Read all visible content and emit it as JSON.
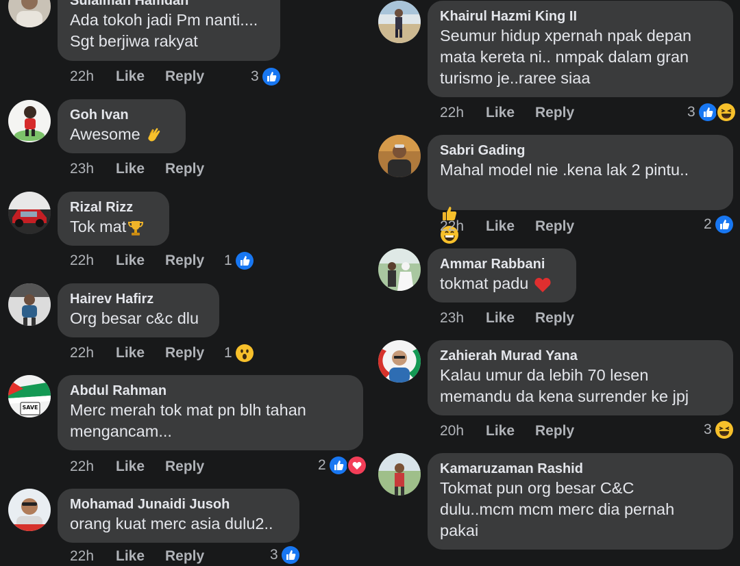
{
  "left": [
    {
      "name": "Sulaiman Hamdan",
      "text": "Ada tokoh jadi Pm nanti....\nSgt berjiwa rakyat",
      "time": "22h",
      "like": "Like",
      "reply": "Reply",
      "count": "3",
      "reactions": [
        "like"
      ]
    },
    {
      "name": "Goh Ivan",
      "text": "Awesome",
      "time": "23h",
      "like": "Like",
      "reply": "Reply",
      "count": "",
      "reactions": [],
      "emoji": "clap-icon"
    },
    {
      "name": "Rizal Rizz",
      "text": "Tok mat",
      "time": "22h",
      "like": "Like",
      "reply": "Reply",
      "count": "1",
      "reactions": [
        "like"
      ],
      "emoji": "trophy-icon"
    },
    {
      "name": "Hairev Hafirz",
      "text": "Org besar c&c dlu",
      "time": "22h",
      "like": "Like",
      "reply": "Reply",
      "count": "1",
      "reactions": [
        "wow"
      ]
    },
    {
      "name": "Abdul Rahman",
      "text": "Merc merah tok mat pn blh tahan\nmengancam...",
      "time": "22h",
      "like": "Like",
      "reply": "Reply",
      "count": "2",
      "reactions": [
        "like",
        "love"
      ]
    },
    {
      "name": "Mohamad Junaidi Jusoh",
      "text": "orang kuat merc asia dulu2..",
      "time": "22h",
      "like": "Like",
      "reply": "Reply",
      "count": "3",
      "reactions": [
        "like"
      ]
    }
  ],
  "right": [
    {
      "name": "Khairul Hazmi King II",
      "text": "Seumur hidup xpernah npak depan\nmata kereta ni.. nmpak dalam gran\nturismo je..raree siaa",
      "time": "22h",
      "like": "Like",
      "reply": "Reply",
      "count": "3",
      "reactions": [
        "like",
        "haha"
      ]
    },
    {
      "name": "Sabri Gading",
      "text": "Mahal model nie .kena lak 2 pintu..",
      "time": "22h",
      "like": "Like",
      "reply": "Reply",
      "count": "2",
      "reactions": [
        "like"
      ],
      "emoji_line": [
        "thumbs-up-icon",
        "grin-icon"
      ]
    },
    {
      "name": "Ammar Rabbani",
      "text": "tokmat padu",
      "time": "23h",
      "like": "Like",
      "reply": "Reply",
      "count": "",
      "reactions": [],
      "emoji": "heart-icon"
    },
    {
      "name": "Zahierah Murad Yana",
      "text": "Kalau umur da lebih 70 lesen\nmemandu da kena surrender ke jpj",
      "time": "20h",
      "like": "Like",
      "reply": "Reply",
      "count": "3",
      "reactions": [
        "haha"
      ]
    },
    {
      "name": "Kamaruzaman Rashid",
      "text": "Tokmat pun org besar C&C\ndulu..mcm mcm merc dia pernah\npakai",
      "time": "",
      "like": "",
      "reply": "",
      "count": "",
      "reactions": []
    }
  ],
  "colors": {
    "background": "#18191a",
    "bubble": "#3a3b3c",
    "meta": "#b0b3b8",
    "like_blue": "#1877f2",
    "love_red": "#f33e58"
  }
}
